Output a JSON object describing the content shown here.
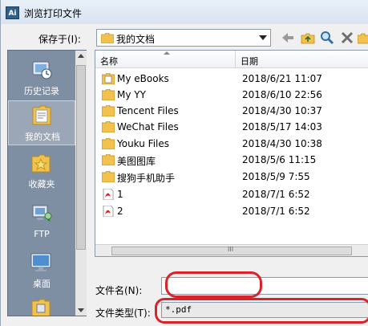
{
  "window": {
    "title": "浏览打印文件",
    "app_icon_text": "Ai"
  },
  "save_in": {
    "label": "保存于(I):",
    "value": "我的文档"
  },
  "toolbar": [
    "back-icon",
    "up-folder-icon",
    "search-icon",
    "delete-icon",
    "new-folder-icon"
  ],
  "places": [
    {
      "label": "历史记录",
      "icon": "history-icon"
    },
    {
      "label": "我的文档",
      "icon": "my-documents-icon"
    },
    {
      "label": "收藏夹",
      "icon": "favorites-icon"
    },
    {
      "label": "FTP",
      "icon": "ftp-icon"
    },
    {
      "label": "桌面",
      "icon": "desktop-icon"
    }
  ],
  "columns": {
    "name": "名称",
    "date": "日期"
  },
  "files": [
    {
      "name": "My eBooks",
      "date": "2018/6/21 11:07",
      "type": "special-folder"
    },
    {
      "name": "My YY",
      "date": "2018/6/10 22:56",
      "type": "folder"
    },
    {
      "name": "Tencent Files",
      "date": "2018/4/30 10:37",
      "type": "folder"
    },
    {
      "name": "WeChat Files",
      "date": "2018/5/17 14:03",
      "type": "folder"
    },
    {
      "name": "Youku Files",
      "date": "2018/4/30 10:38",
      "type": "folder"
    },
    {
      "name": "美图图库",
      "date": "2018/5/6 11:15",
      "type": "folder"
    },
    {
      "name": "搜狗手机助手",
      "date": "2018/5/9 7:55",
      "type": "folder"
    },
    {
      "name": "1",
      "date": "2018/7/1 6:52",
      "type": "pdf"
    },
    {
      "name": "2",
      "date": "2018/7/1 6:52",
      "type": "pdf"
    }
  ],
  "file_name": {
    "label": "文件名(N):",
    "value": ""
  },
  "file_type": {
    "label": "文件类型(T):",
    "value": "*.pdf"
  },
  "hscroll_grip": "III",
  "colors": {
    "highlight": "#d8232a",
    "places_bg": "#7f8fa3",
    "folder": "#f2c14e"
  }
}
